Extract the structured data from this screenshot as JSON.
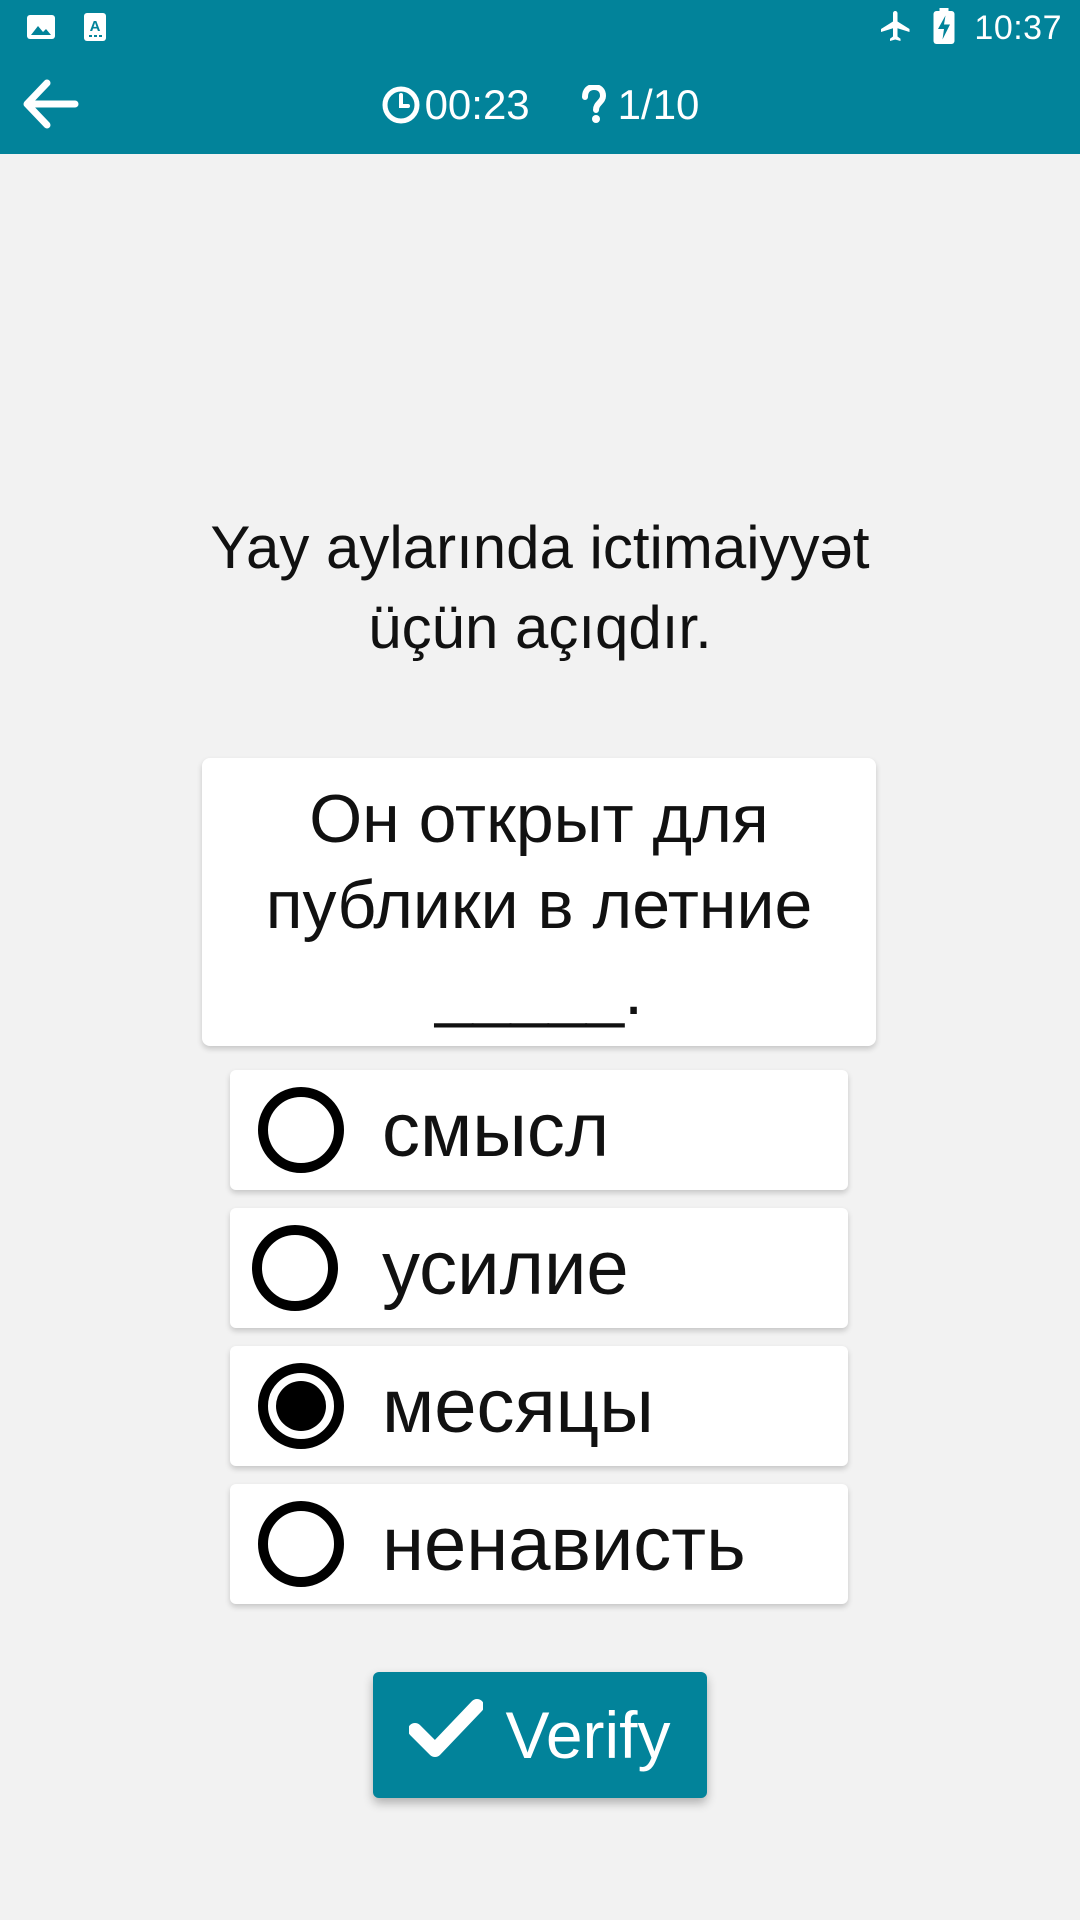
{
  "status_bar": {
    "time": "10:37",
    "icons": [
      "gallery-icon",
      "text-a-icon",
      "airplane-mode-icon",
      "battery-charging-icon"
    ]
  },
  "toolbar": {
    "back_icon": "arrow-back-icon",
    "timer": "00:23",
    "timer_icon": "clock-icon",
    "progress": "1/10",
    "progress_icon": "question-mark-icon"
  },
  "question": {
    "source_text": "Yay aylarında ictimaiyyət üçün açıqdır.",
    "prompt_text": "Он открыт для публики в летние _____."
  },
  "options": [
    {
      "label": "смысл",
      "selected": false
    },
    {
      "label": "усилие",
      "selected": false
    },
    {
      "label": "месяцы",
      "selected": true
    },
    {
      "label": "ненависть",
      "selected": false
    }
  ],
  "verify_button": {
    "label": "Verify",
    "icon": "checkmark-icon"
  },
  "colors": {
    "accent": "#02839a",
    "background": "#f2f2f2"
  }
}
